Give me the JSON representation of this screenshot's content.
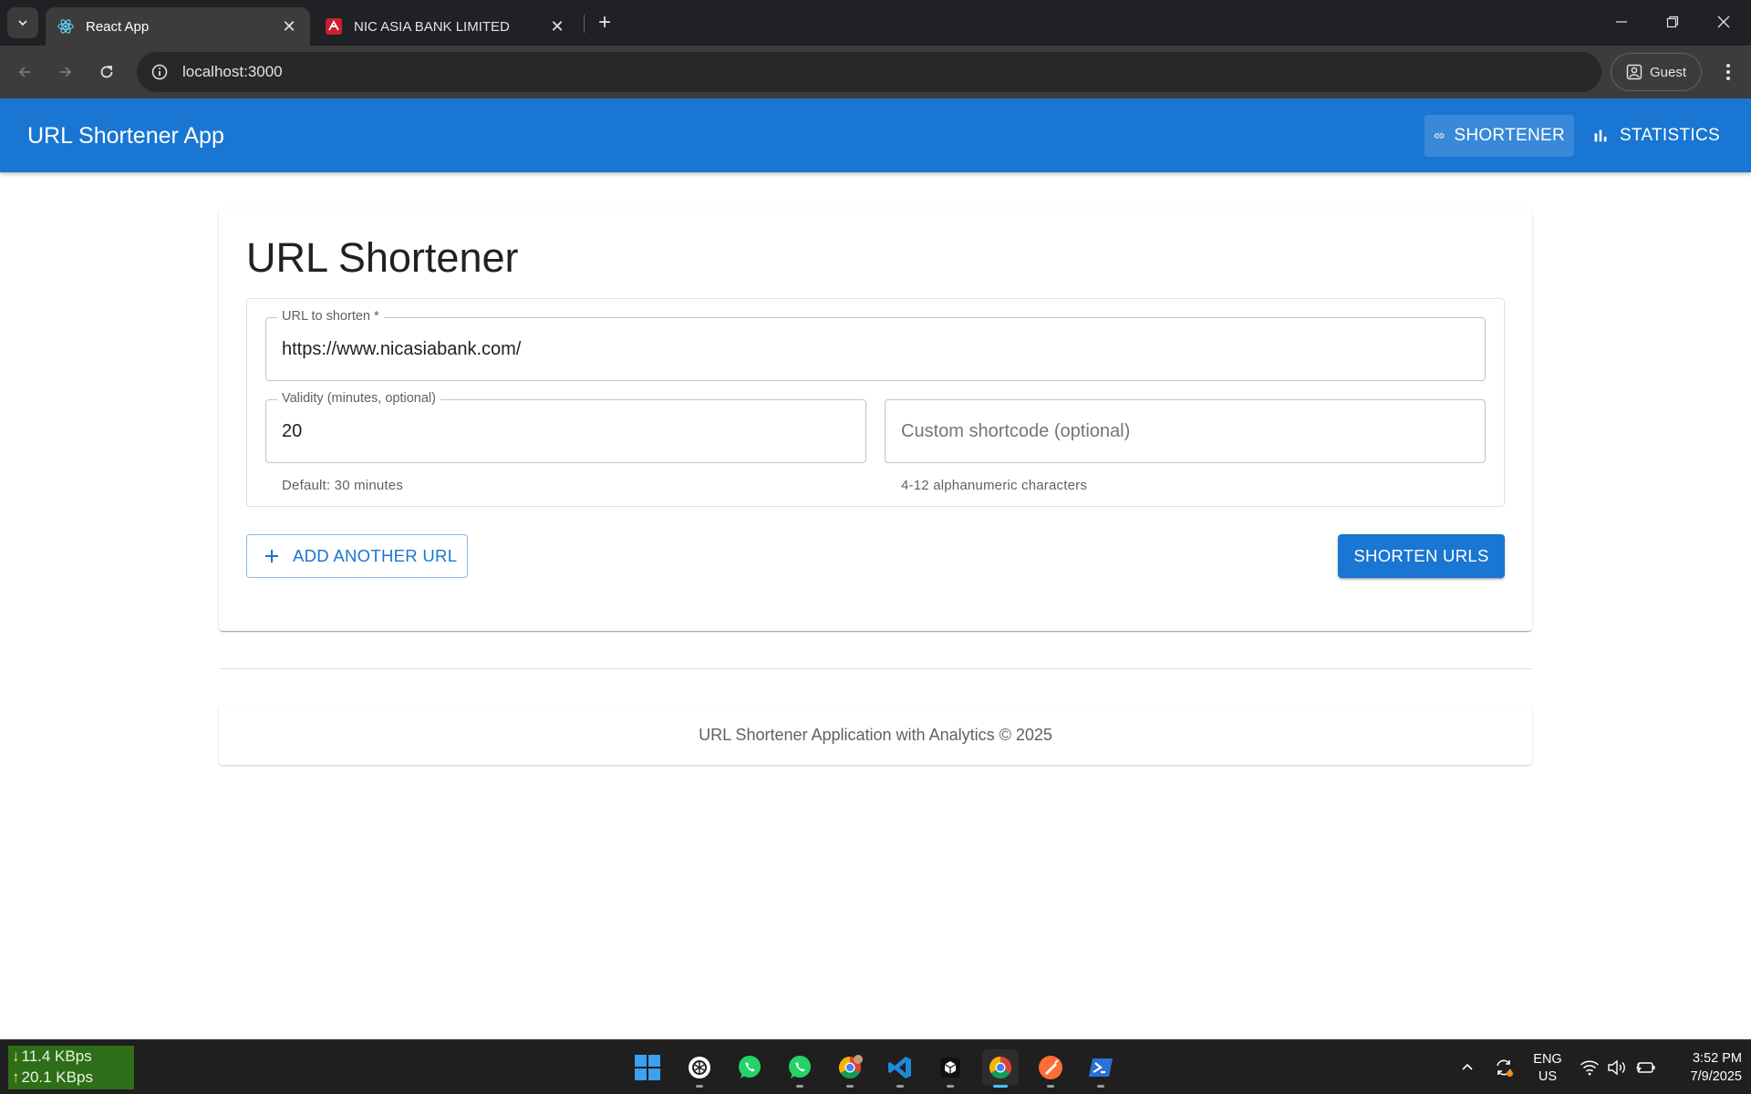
{
  "browser": {
    "tabs": [
      {
        "title": "React App",
        "active": true
      },
      {
        "title": "NIC ASIA BANK LIMITED",
        "active": false
      }
    ],
    "address": "localhost:3000",
    "profile_label": "Guest"
  },
  "app": {
    "brand": "URL Shortener App",
    "nav": [
      {
        "label": "SHORTENER",
        "icon": "link-icon",
        "active": true
      },
      {
        "label": "STATISTICS",
        "icon": "bar-chart-icon",
        "active": false
      }
    ],
    "accent_color": "#1976d2"
  },
  "shortener": {
    "title": "URL Shortener",
    "url_field": {
      "label": "URL to shorten *",
      "value": "https://www.nicasiabank.com/"
    },
    "validity_field": {
      "label": "Validity (minutes, optional)",
      "value": "20",
      "helper": "Default: 30 minutes"
    },
    "shortcode_field": {
      "placeholder": "Custom shortcode (optional)",
      "helper": "4-12 alphanumeric characters"
    },
    "add_button": "ADD ANOTHER URL",
    "submit_button": "SHORTEN URLS"
  },
  "footer": {
    "text": "URL Shortener Application with Analytics © 2025"
  },
  "taskbar": {
    "net_down": "11.4 KBps",
    "net_up": "20.1 KBps",
    "lang_primary": "ENG",
    "lang_secondary": "US",
    "time": "3:52 PM",
    "date": "7/9/2025",
    "apps": [
      "windows-start-icon",
      "chatgpt-icon",
      "whatsapp-icon",
      "whatsapp-beta-icon",
      "chrome-profile-icon",
      "vscode-icon",
      "terminal-app-icon",
      "chrome-icon",
      "postman-icon",
      "powershell-icon"
    ]
  }
}
